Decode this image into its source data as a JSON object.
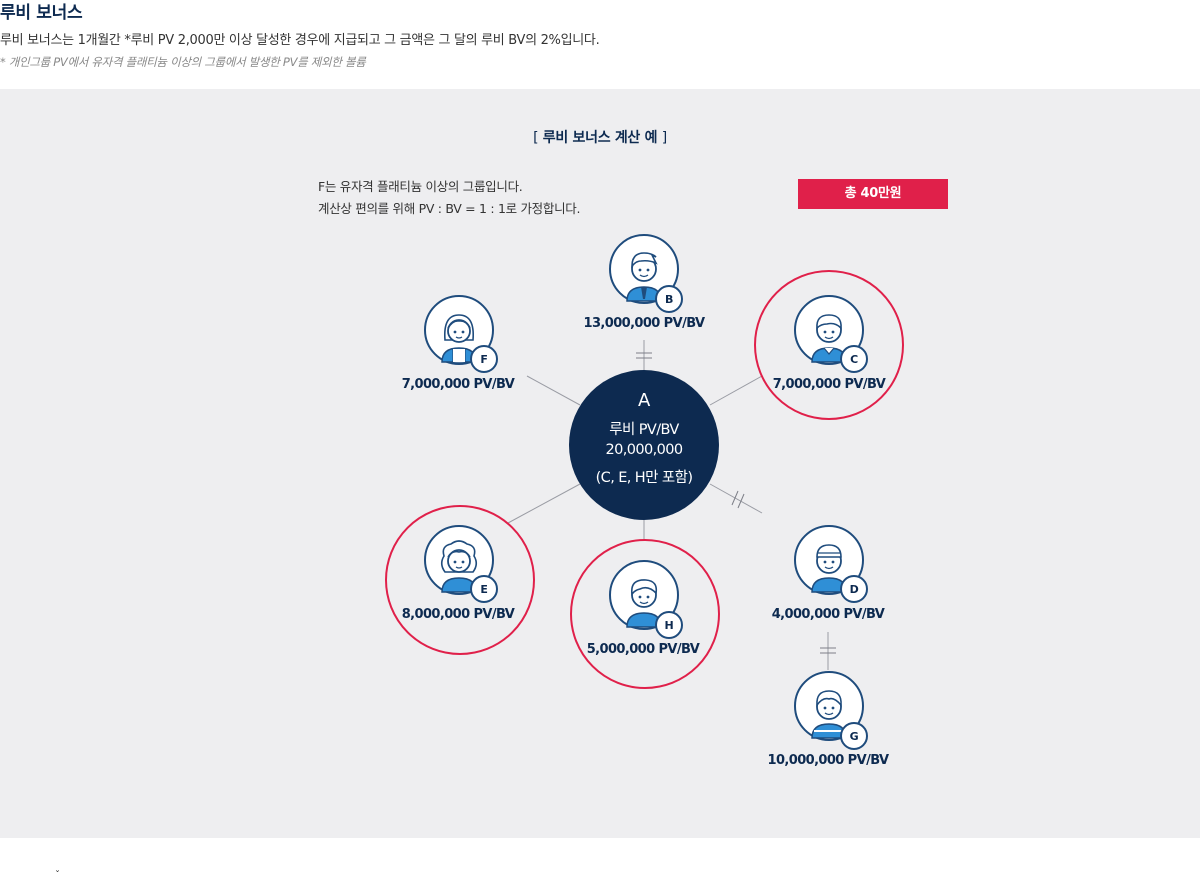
{
  "section": {
    "title": "루비 보너스",
    "description": "루비 보너스는 1개월간 *루비 PV 2,000만 이상 달성한 경우에 지급되고 그 금액은 그 달의 루비 BV의 2%입니다.",
    "note": "*  개인그룹 PV에서 유자격 플래티늄 이상의 그룹에서 발생한 PV를 제외한 볼륨"
  },
  "example": {
    "title_open": "[",
    "title": " 루비 보너스 계산 예 ",
    "title_close": "]",
    "intro_line1": "F는 유자격 플래티늄 이상의 그룹입니다.",
    "intro_line2": "계산상 편의를 위해 PV : BV = 1 : 1로 가정합니다.",
    "total": "총 40만원"
  },
  "center_node": {
    "letter": "A",
    "line1": "루비 PV/BV",
    "line2": "20,000,000",
    "line3": "(C, E, H만 포함)",
    "color": "#0d2a50"
  },
  "nodes": [
    {
      "id": "B",
      "label": "13,000,000 PV/BV",
      "highlighted": false,
      "icon": "boy-with-tie-icon"
    },
    {
      "id": "C",
      "label": "7,000,000 PV/BV",
      "highlighted": true,
      "icon": "boy-icon"
    },
    {
      "id": "F",
      "label": "7,000,000 PV/BV",
      "highlighted": false,
      "icon": "girl-icon"
    },
    {
      "id": "E",
      "label": "8,000,000 PV/BV",
      "highlighted": true,
      "icon": "curly-hair-woman-icon"
    },
    {
      "id": "H",
      "label": "5,000,000 PV/BV",
      "highlighted": true,
      "icon": "boy-icon"
    },
    {
      "id": "D",
      "label": "4,000,000 PV/BV",
      "highlighted": false,
      "icon": "child-with-cap-icon"
    },
    {
      "id": "G",
      "label": "10,000,000 PV/BV",
      "highlighted": false,
      "icon": "child-icon"
    }
  ],
  "colors": {
    "navy": "#0d2a50",
    "highlight_ring": "#e0204a",
    "total_badge": "#e0204a",
    "panel_bg": "#eeeef0",
    "shirt_blue": "#2f8fd6"
  },
  "footer": {
    "mark": "ˇ"
  }
}
